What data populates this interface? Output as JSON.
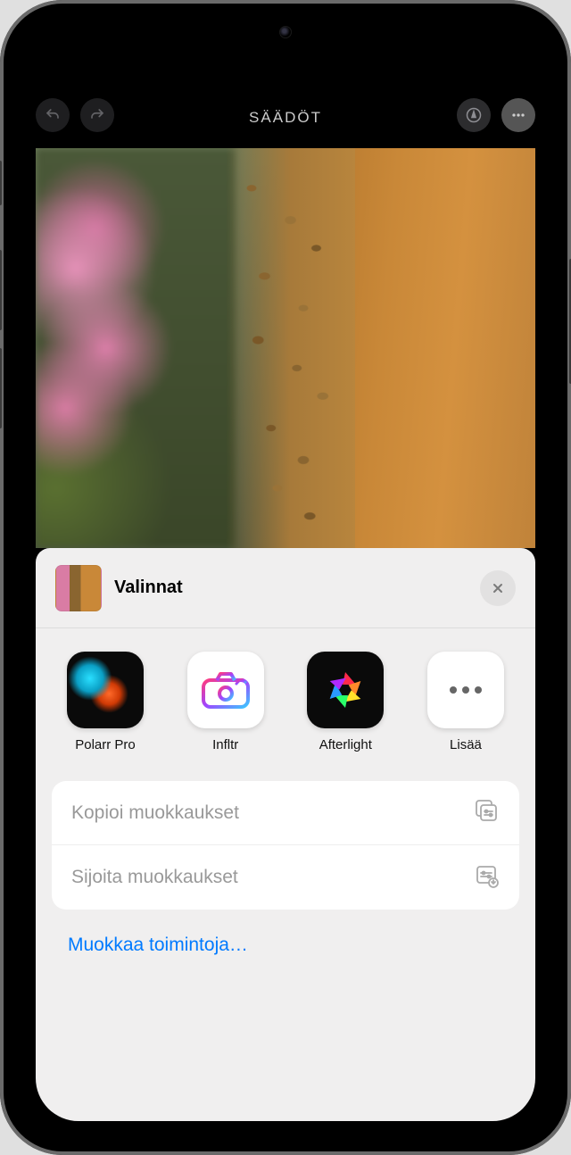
{
  "toolbar": {
    "title": "SÄÄDÖT"
  },
  "sheet": {
    "title": "Valinnat",
    "apps": [
      {
        "label": "Polarr Pro"
      },
      {
        "label": "Infltr"
      },
      {
        "label": "Afterlight"
      },
      {
        "label": "Lisää"
      }
    ],
    "actions": [
      {
        "label": "Kopioi muokkaukset"
      },
      {
        "label": "Sijoita muokkaukset"
      }
    ],
    "edit_actions_label": "Muokkaa toimintoja…"
  }
}
